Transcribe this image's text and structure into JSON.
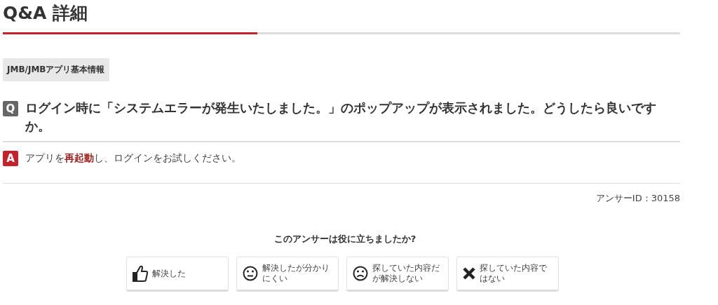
{
  "title": "Q&A 詳細",
  "category": "JMB/JMBアプリ基本情報",
  "question": {
    "badge": "Q",
    "text": "ログイン時に「システムエラーが発生いたしました。」のポップアップが表示されました。どうしたら良いですか。"
  },
  "answer": {
    "badge": "A",
    "text": "アプリを**再起動**し、ログインをお試しください。"
  },
  "answer_id": "アンサーID：30158",
  "feedback": {
    "prompt": "このアンサーは役に立ちましたか?",
    "buttons": [
      {
        "kind": "thumb",
        "label": "解決した"
      },
      {
        "kind": "neutral",
        "label": "解決したが分かりにくい"
      },
      {
        "kind": "sad",
        "label": "探していた内容だが解決しない"
      },
      {
        "kind": "cross",
        "label": "探していた内容ではない"
      }
    ]
  }
}
